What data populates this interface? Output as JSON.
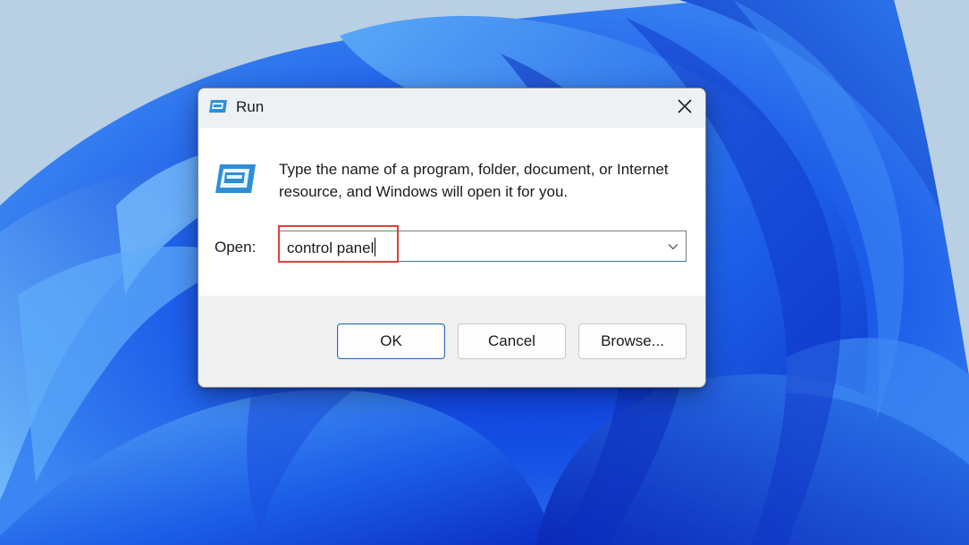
{
  "dialog": {
    "title": "Run",
    "description": "Type the name of a program, folder, document, or Internet resource, and Windows will open it for you.",
    "open_label": "Open:",
    "open_value": "control panel",
    "buttons": {
      "ok": "OK",
      "cancel": "Cancel",
      "browse": "Browse..."
    },
    "icons": {
      "title": "run-icon",
      "content": "run-icon",
      "close": "close-icon",
      "dropdown": "chevron-down-icon"
    }
  },
  "annotation": {
    "highlight_color": "#e0403a"
  },
  "colors": {
    "accent": "#2b6cb3",
    "wallpaper_background": "#b9cfe3",
    "wallpaper_bloom": "#1f5ee8"
  }
}
